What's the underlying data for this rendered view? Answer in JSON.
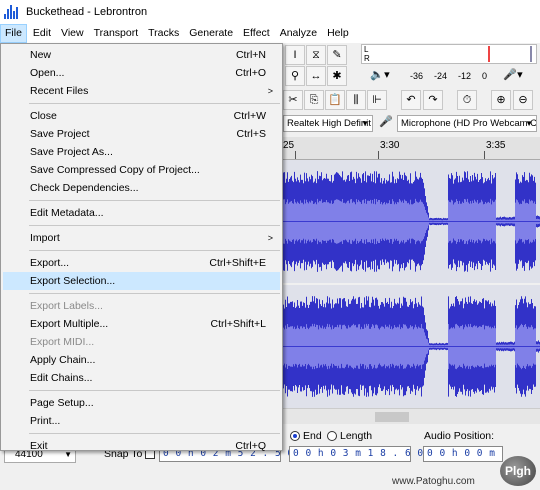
{
  "window": {
    "title": "Buckethead - Lebrontron"
  },
  "menubar": [
    "File",
    "Edit",
    "View",
    "Transport",
    "Tracks",
    "Generate",
    "Effect",
    "Analyze",
    "Help"
  ],
  "file_menu": {
    "new": "New",
    "new_sc": "Ctrl+N",
    "open": "Open...",
    "open_sc": "Ctrl+O",
    "recent": "Recent Files",
    "close": "Close",
    "close_sc": "Ctrl+W",
    "save": "Save Project",
    "save_sc": "Ctrl+S",
    "save_as": "Save Project As...",
    "save_compressed": "Save Compressed Copy of Project...",
    "check_deps": "Check Dependencies...",
    "edit_meta": "Edit Metadata...",
    "import": "Import",
    "export": "Export...",
    "export_sc": "Ctrl+Shift+E",
    "export_sel": "Export Selection...",
    "export_labels": "Export Labels...",
    "export_multiple": "Export Multiple...",
    "export_multiple_sc": "Ctrl+Shift+L",
    "export_midi": "Export MIDI...",
    "apply_chain": "Apply Chain...",
    "edit_chains": "Edit Chains...",
    "page_setup": "Page Setup...",
    "print": "Print...",
    "exit": "Exit",
    "exit_sc": "Ctrl+Q"
  },
  "meter": {
    "L": "L",
    "R": "R",
    "db_36": "-36",
    "db_24": "-24",
    "db_12": "-12",
    "db_0": "0"
  },
  "devices": {
    "output": "Realtek High Definit",
    "input": "Microphone (HD Pro Webcam C"
  },
  "ruler": {
    "t1": "25",
    "t2": "3:30",
    "t3": "3:35"
  },
  "bottom": {
    "rate": "44100",
    "snap_to": "Snap To",
    "sel_start": "0 0 h 0 2 m 5 2 . 5 0 8 s",
    "end_label": "End",
    "length_label": "Length",
    "sel_end": "0 0 h 0 3 m 1 8 . 6 0 8 s",
    "audio_pos_label": "Audio Position:",
    "audio_pos": "0 0 h 0 0 m",
    "unit_s": "s"
  },
  "watermark": {
    "text": "www.Patoghu.com",
    "logo": "Plgh"
  },
  "colors": {
    "waveform": "#3232c8",
    "waveform_light": "#8080e8",
    "highlight": "#cce8ff"
  }
}
